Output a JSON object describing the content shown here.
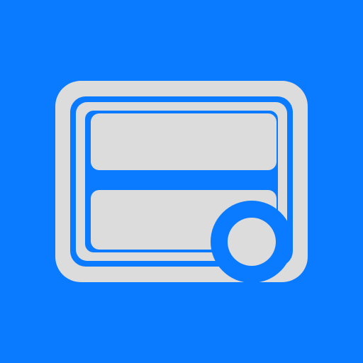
{
  "app_icon": {
    "icon": "layout-panels-badge-icon",
    "colors": {
      "background": "#0a7bff",
      "foreground": "#dcdcdc",
      "accent": "#0a7bff"
    }
  }
}
